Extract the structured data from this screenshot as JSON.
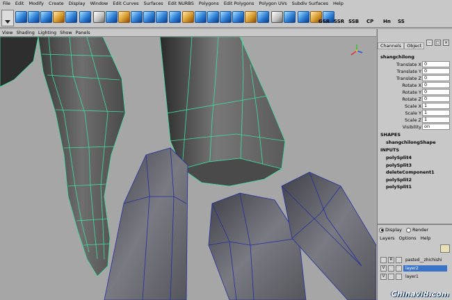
{
  "menubar": [
    "File",
    "Edit",
    "Modify",
    "Create",
    "Display",
    "Window",
    "Edit Curves",
    "Surfaces",
    "Edit NURBS",
    "Polygons",
    "Edit Polygons",
    "Polygon UVs",
    "Subdiv Surfaces",
    "Help"
  ],
  "shelf": {
    "text_buttons": [
      "GSR",
      "SSR",
      "SSB",
      "CP",
      "Hn",
      "SS"
    ]
  },
  "panel_menu": [
    "View",
    "Shading",
    "Lighting",
    "Show",
    "Panels"
  ],
  "channel_box": {
    "tabs": [
      "Channels",
      "Object"
    ],
    "object_name": "shangchilong",
    "attributes": [
      {
        "label": "Translate X",
        "value": "0"
      },
      {
        "label": "Translate Y",
        "value": "0"
      },
      {
        "label": "Translate Z",
        "value": "0"
      },
      {
        "label": "Rotate X",
        "value": "0"
      },
      {
        "label": "Rotate Y",
        "value": "0"
      },
      {
        "label": "Rotate Z",
        "value": "0"
      },
      {
        "label": "Scale X",
        "value": "1"
      },
      {
        "label": "Scale Y",
        "value": "1"
      },
      {
        "label": "Scale Z",
        "value": "1"
      },
      {
        "label": "Visibility",
        "value": "on"
      }
    ],
    "shapes_header": "SHAPES",
    "shape_name": "shangchilongShape",
    "inputs_header": "INPUTS",
    "inputs": [
      "polySplit4",
      "polySplit3",
      "deleteComponent1",
      "polySplit2",
      "polySplit1"
    ]
  },
  "layer_editor": {
    "display_label": "Display",
    "render_label": "Render",
    "menu": [
      "Layers",
      "Options",
      "Help"
    ],
    "layers": [
      {
        "v": "",
        "r": "R",
        "name": "pasted__zhichishi"
      },
      {
        "v": "V",
        "r": "",
        "name": "layer2"
      },
      {
        "v": "V",
        "r": "",
        "name": "layer1"
      }
    ]
  },
  "watermark": "Chinavid.com",
  "colors": {
    "ui_bg": "#c8c8c8",
    "viewport_bg": "#a6a6a6",
    "wireframe": "#40e0a0",
    "selected_layer": "#3b74c7"
  }
}
